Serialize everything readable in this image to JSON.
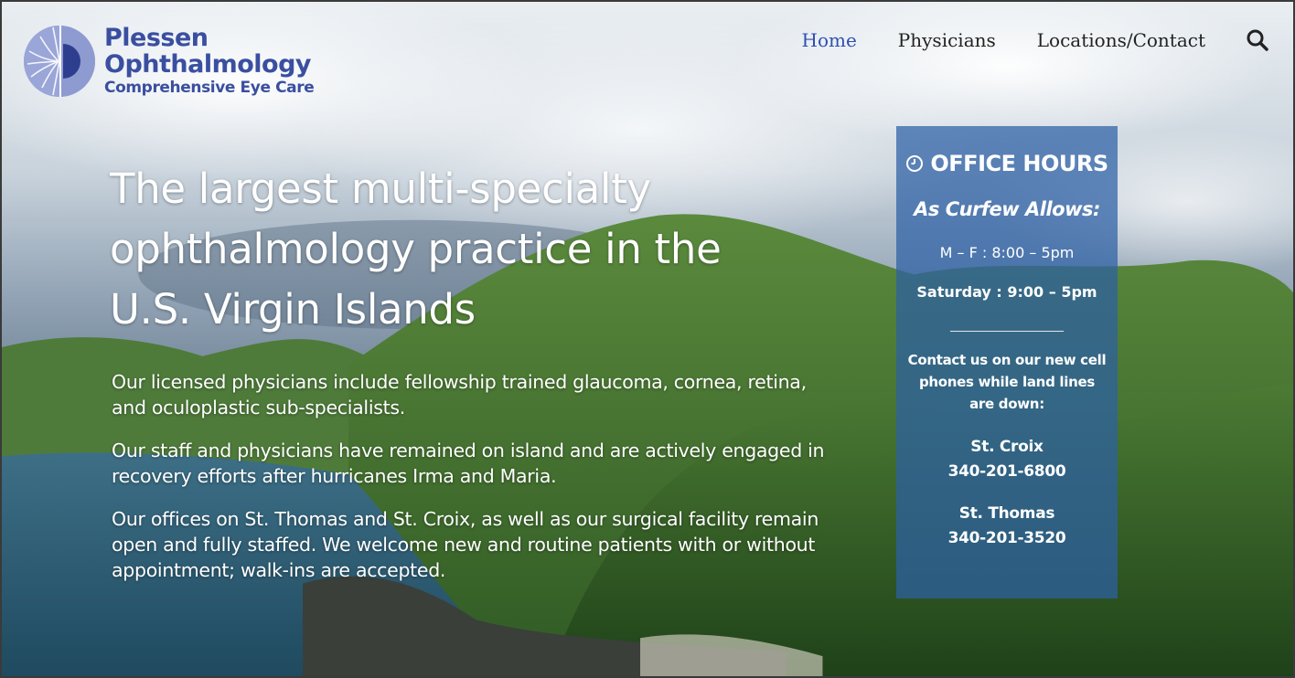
{
  "logo": {
    "name_line1": "Plessen",
    "name_line2": "Ophthalmology",
    "tagline": "Comprehensive Eye Care"
  },
  "nav": {
    "items": [
      {
        "label": "Home",
        "active": true
      },
      {
        "label": "Physicians",
        "active": false
      },
      {
        "label": "Locations/Contact",
        "active": false
      }
    ],
    "search_icon": "search-icon"
  },
  "hero": {
    "headline_lines": [
      "The largest multi-specialty",
      "ophthalmology practice in the",
      "U.S. Virgin Islands"
    ],
    "paragraphs": [
      "Our licensed physicians include fellowship trained glaucoma, cornea, retina, and oculoplastic sub-specialists.",
      "Our staff and physicians have remained on island and are actively engaged in recovery efforts after hurricanes Irma and Maria.",
      "Our offices on St. Thomas and St. Croix, as well as our surgical facility remain open and fully staffed. We welcome new and routine patients with or without appointment; walk-ins are accepted."
    ]
  },
  "office_hours": {
    "title": "OFFICE HOURS",
    "subtitle": "As Curfew Allows:",
    "weekday": "M – F : 8:00 – 5pm",
    "saturday": "Saturday : 9:00 – 5pm",
    "contact_note": "Contact us on our new cell phones while land lines are down:",
    "locations": [
      {
        "name": "St. Croix",
        "phone": "340-201-6800"
      },
      {
        "name": "St. Thomas",
        "phone": "340-201-3520"
      }
    ]
  },
  "colors": {
    "brand": "#3a4fa0",
    "nav_active": "#2f4fb0",
    "panel": "#2c5fa5"
  }
}
